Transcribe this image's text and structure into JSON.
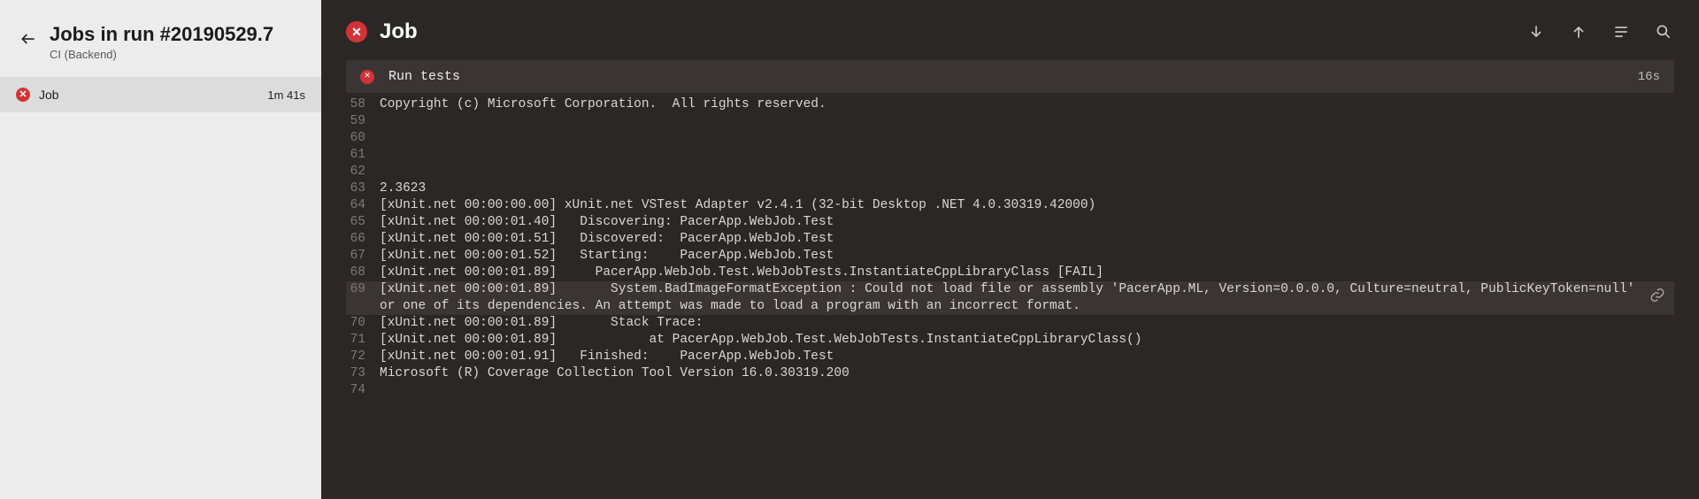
{
  "sidebar": {
    "title": "Jobs in run #20190529.7",
    "subtitle": "CI (Backend)",
    "jobs": [
      {
        "name": "Job",
        "duration": "1m 41s"
      }
    ]
  },
  "main": {
    "title": "Job",
    "toolbar": {
      "scroll_down": "Scroll to bottom",
      "scroll_up": "Scroll to top",
      "word_wrap": "Toggle word wrap",
      "search": "Search log"
    },
    "step": {
      "name": "Run tests",
      "duration": "16s"
    },
    "log": [
      {
        "n": "58",
        "t": "Copyright (c) Microsoft Corporation.  All rights reserved.",
        "hi": false
      },
      {
        "n": "59",
        "t": "",
        "hi": false
      },
      {
        "n": "60",
        "t": "",
        "hi": false
      },
      {
        "n": "61",
        "t": "",
        "hi": false
      },
      {
        "n": "62",
        "t": "",
        "hi": false
      },
      {
        "n": "63",
        "t": "2.3623",
        "hi": false
      },
      {
        "n": "64",
        "t": "[xUnit.net 00:00:00.00] xUnit.net VSTest Adapter v2.4.1 (32-bit Desktop .NET 4.0.30319.42000)",
        "hi": false
      },
      {
        "n": "65",
        "t": "[xUnit.net 00:00:01.40]   Discovering: PacerApp.WebJob.Test",
        "hi": false
      },
      {
        "n": "66",
        "t": "[xUnit.net 00:00:01.51]   Discovered:  PacerApp.WebJob.Test",
        "hi": false
      },
      {
        "n": "67",
        "t": "[xUnit.net 00:00:01.52]   Starting:    PacerApp.WebJob.Test",
        "hi": false
      },
      {
        "n": "68",
        "t": "[xUnit.net 00:00:01.89]     PacerApp.WebJob.Test.WebJobTests.InstantiateCppLibraryClass [FAIL]",
        "hi": false
      },
      {
        "n": "69",
        "t": "[xUnit.net 00:00:01.89]       System.BadImageFormatException : Could not load file or assembly 'PacerApp.ML, Version=0.0.0.0, Culture=neutral, PublicKeyToken=null' or one of its dependencies. An attempt was made to load a program with an incorrect format.",
        "hi": true,
        "link": true
      },
      {
        "n": "70",
        "t": "[xUnit.net 00:00:01.89]       Stack Trace:",
        "hi": false
      },
      {
        "n": "71",
        "t": "[xUnit.net 00:00:01.89]            at PacerApp.WebJob.Test.WebJobTests.InstantiateCppLibraryClass()",
        "hi": false
      },
      {
        "n": "72",
        "t": "[xUnit.net 00:00:01.91]   Finished:    PacerApp.WebJob.Test",
        "hi": false
      },
      {
        "n": "73",
        "t": "Microsoft (R) Coverage Collection Tool Version 16.0.30319.200",
        "hi": false
      },
      {
        "n": "74",
        "t": "",
        "hi": false
      }
    ]
  }
}
